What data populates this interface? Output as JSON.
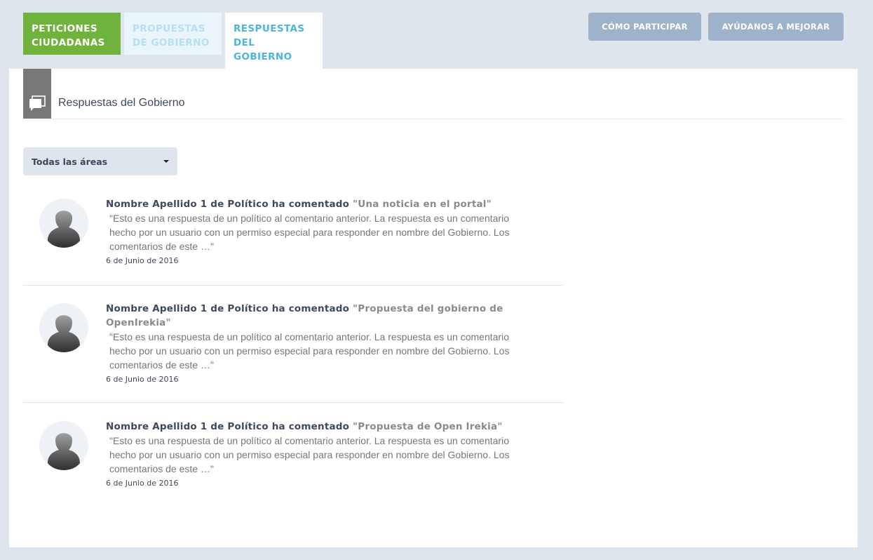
{
  "tabs": [
    {
      "label_line1": "PETICIONES",
      "label_line2": "CIUDADANAS"
    },
    {
      "label_line1": "PROPUESTAS",
      "label_line2": "DE GOBIERNO"
    },
    {
      "label_line1": "RESPUESTAS",
      "label_line2": "DEL",
      "label_line3": "GOBIERNO"
    }
  ],
  "header_buttons": {
    "participar": "CÓMO PARTICIPAR",
    "mejorar": "AYÚDANOS A MEJORAR"
  },
  "section": {
    "icon": "speech-bubble-icon",
    "title": "Respuestas del Gobierno"
  },
  "filter": {
    "selected": "Todas las áreas"
  },
  "responses": [
    {
      "author_action": "Nombre Apellido 1 de Político ha comentado",
      "link_title": "\"Una noticia en el portal\"",
      "excerpt_line1": "\"Esto es una respuesta de un político al comentario anterior. La respuesta es un comentario",
      "excerpt_line2": "hecho por un usuario con un permiso especial para responder en nombre del Gobierno. Los",
      "excerpt_line3": "comentarios de este …\"",
      "date": "6 de Junio de 2016"
    },
    {
      "author_action": "Nombre Apellido 1 de Político ha comentado",
      "link_title_line1": "\"Propuesta del gobierno de",
      "link_title_line2": "OpenIrekia\"",
      "excerpt_line1": "\"Esto es una respuesta de un político al comentario anterior. La respuesta es un comentario",
      "excerpt_line2": "hecho por un usuario con un permiso especial para responder en nombre del Gobierno. Los",
      "excerpt_line3": "comentarios de este …\"",
      "date": "6 de Junio de 2016"
    },
    {
      "author_action": "Nombre Apellido 1 de Político ha comentado",
      "link_title": "\"Propuesta de Open Irekia\"",
      "excerpt_line1": "\"Esto es una respuesta de un político al comentario anterior. La respuesta es un comentario",
      "excerpt_line2": "hecho por un usuario con un permiso especial para responder en nombre del Gobierno. Los",
      "excerpt_line3": "comentarios de este …\"",
      "date": "6 de Junio de 2016"
    }
  ],
  "colors": {
    "page_bg": "#dfe5ed",
    "tab_peticiones": "#6fb23c",
    "tab_propuestas_bg": "#eaf5fb",
    "tab_active_text": "#4bb5db",
    "header_button": "#9eb2c9"
  }
}
